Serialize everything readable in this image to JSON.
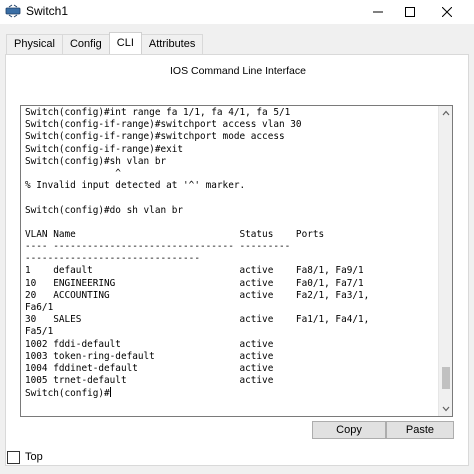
{
  "window": {
    "title": "Switch1",
    "icon": "switch-app-icon",
    "minimize_icon": "minimize-icon",
    "maximize_icon": "maximize-icon",
    "close_icon": "close-icon"
  },
  "tabs": [
    {
      "label": "Physical",
      "active": false
    },
    {
      "label": "Config",
      "active": false
    },
    {
      "label": "CLI",
      "active": true
    },
    {
      "label": "Attributes",
      "active": false
    }
  ],
  "panel": {
    "title": "IOS Command Line Interface"
  },
  "terminal": {
    "lines": [
      "Switch(config)#int range fa 1/1, fa 4/1, fa 5/1",
      "Switch(config-if-range)#switchport access vlan 30",
      "Switch(config-if-range)#switchport mode access",
      "Switch(config-if-range)#exit",
      "Switch(config)#sh vlan br",
      "                ^",
      "% Invalid input detected at '^' marker.",
      "",
      "Switch(config)#do sh vlan br",
      "",
      "VLAN Name                             Status    Ports",
      "---- -------------------------------- ---------",
      "-------------------------------",
      "1    default                          active    Fa8/1, Fa9/1",
      "10   ENGINEERING                      active    Fa0/1, Fa7/1",
      "20   ACCOUNTING                       active    Fa2/1, Fa3/1,",
      "Fa6/1",
      "30   SALES                            active    Fa1/1, Fa4/1,",
      "Fa5/1",
      "1002 fddi-default                     active",
      "1003 token-ring-default               active",
      "1004 fddinet-default                  active",
      "1005 trnet-default                    active"
    ],
    "prompt": "Switch(config)#",
    "scroll_position": 0.95
  },
  "buttons": {
    "copy": "Copy",
    "paste": "Paste"
  },
  "footer": {
    "top_label": "Top",
    "top_checked": false
  },
  "colors": {
    "window_bg": "#f0f0f0",
    "button_bg": "#e1e1e1",
    "scroll_thumb": "#c1c1c1"
  }
}
